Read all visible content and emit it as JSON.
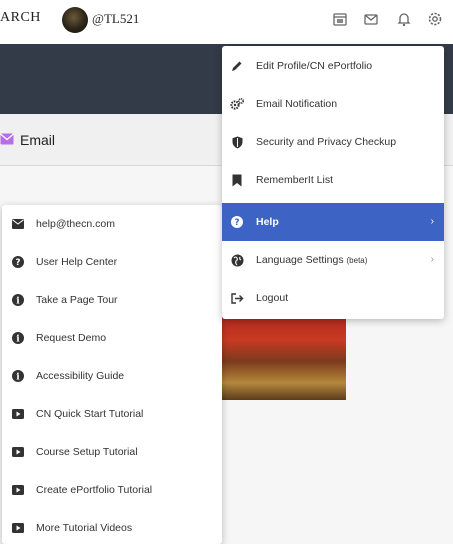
{
  "topbar": {
    "search_text": "ARCH",
    "username": "@TL521"
  },
  "email_tab": {
    "label": "Email"
  },
  "main_menu": {
    "items": [
      {
        "label": "Edit Profile/CN ePortfolio",
        "icon": "pencil-icon"
      },
      {
        "label": "Email Notification",
        "icon": "gears-icon"
      },
      {
        "label": "Security and Privacy Checkup",
        "icon": "shield-icon"
      },
      {
        "label": "RememberIt List",
        "icon": "bookmark-icon"
      },
      {
        "label": "Help",
        "icon": "question-circle-icon",
        "active": true
      },
      {
        "label": "Language Settings",
        "suffix": "(beta)",
        "icon": "globe-icon"
      },
      {
        "label": "Logout",
        "icon": "logout-icon"
      }
    ]
  },
  "help_menu": {
    "items": [
      {
        "label": "help@thecn.com",
        "icon": "envelope-icon"
      },
      {
        "label": "User Help Center",
        "icon": "question-circle-icon"
      },
      {
        "label": "Take a Page Tour",
        "icon": "info-circle-icon"
      },
      {
        "label": "Request Demo",
        "icon": "info-circle-icon"
      },
      {
        "label": "Accessibility Guide",
        "icon": "info-circle-icon"
      },
      {
        "label": "CN Quick Start Tutorial",
        "icon": "video-icon"
      },
      {
        "label": "Course Setup Tutorial",
        "icon": "video-icon"
      },
      {
        "label": "Create ePortfolio Tutorial",
        "icon": "video-icon"
      },
      {
        "label": "More Tutorial Videos",
        "icon": "video-icon"
      }
    ]
  },
  "colors": {
    "active_item_bg": "#3d63c5",
    "header_band": "#343b48",
    "email_icon": "#b76de8"
  }
}
